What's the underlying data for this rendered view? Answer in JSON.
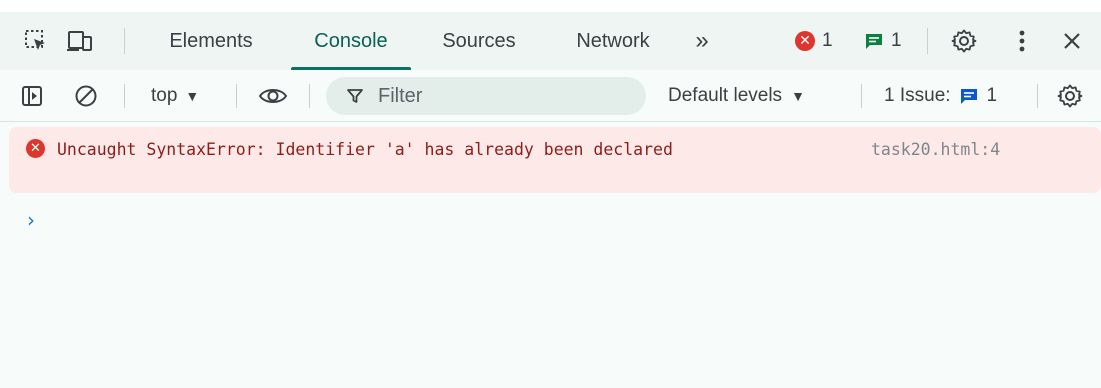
{
  "tabbar": {
    "tabs": [
      {
        "label": "Elements",
        "active": false
      },
      {
        "label": "Console",
        "active": true
      },
      {
        "label": "Sources",
        "active": false
      },
      {
        "label": "Network",
        "active": false
      }
    ],
    "more_tabs": "»",
    "error_count": "1",
    "message_count": "1",
    "accent_color": "#0b6f63"
  },
  "toolbar": {
    "context": "top",
    "filter_placeholder": "Filter",
    "levels_label": "Default levels",
    "issues_label": "1 Issue:",
    "issues_count": "1"
  },
  "console": {
    "messages": [
      {
        "level": "error",
        "text": "Uncaught SyntaxError: Identifier 'a' has already been declared",
        "source": "task20.html:4"
      }
    ],
    "prompt_symbol": "›"
  },
  "colors": {
    "error": "#dc362e",
    "error_bg": "#fde9e8",
    "issue_blue": "#0b57d0",
    "message_green": "#0b8043",
    "prompt": "#1a73e8"
  }
}
